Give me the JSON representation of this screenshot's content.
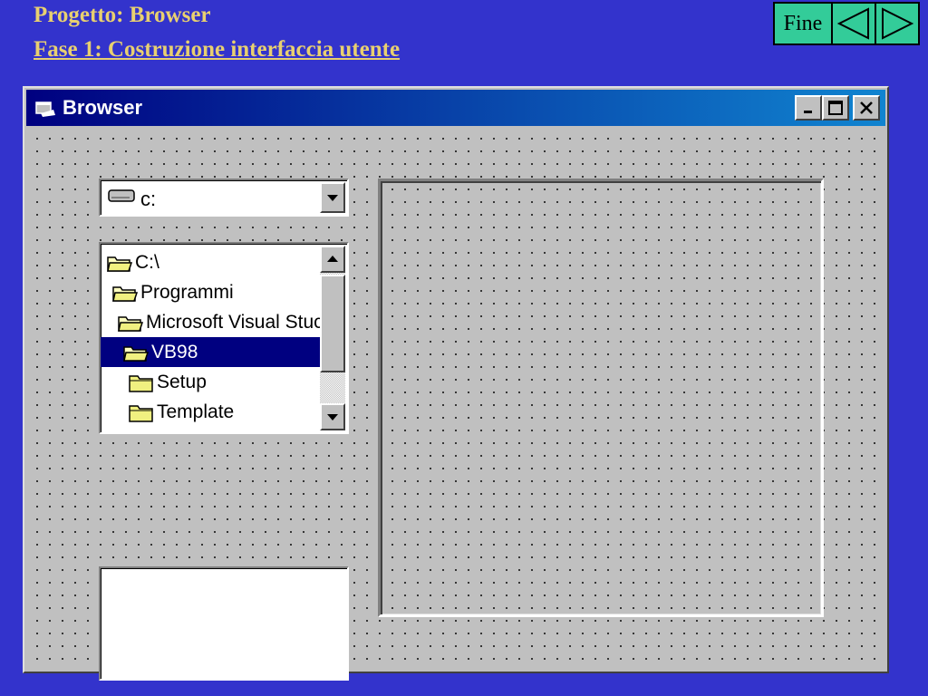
{
  "slide": {
    "title": "Progetto: Browser",
    "subtitle": "Fase 1: Costruzione interfaccia utente",
    "nav": {
      "end_label": "Fine",
      "prev_icon": "arrow-left-icon",
      "next_icon": "arrow-right-icon"
    },
    "colors": {
      "background": "#3333cc",
      "title_text": "#e8d070",
      "nav_buttons": "#33cc99"
    }
  },
  "window": {
    "title": "Browser",
    "icon": "app-window-icon",
    "controls": [
      "minimize-icon",
      "maximize-icon",
      "close-icon"
    ],
    "titlebar_colors": [
      "#000080",
      "#1084d0"
    ]
  },
  "drive_combo": {
    "value": "c:",
    "icon": "drive-icon"
  },
  "dir_list": {
    "items": [
      {
        "label": "C:\\",
        "icon": "folder-open-icon",
        "selected": false
      },
      {
        "label": "Programmi",
        "icon": "folder-open-icon",
        "selected": false
      },
      {
        "label": "Microsoft Visual Stuc",
        "icon": "folder-open-icon",
        "selected": false
      },
      {
        "label": "VB98",
        "icon": "folder-open-icon",
        "selected": true
      },
      {
        "label": "Setup",
        "icon": "folder-closed-icon",
        "selected": false
      },
      {
        "label": "Template",
        "icon": "folder-closed-icon",
        "selected": false
      }
    ]
  },
  "file_list": {
    "items": []
  }
}
